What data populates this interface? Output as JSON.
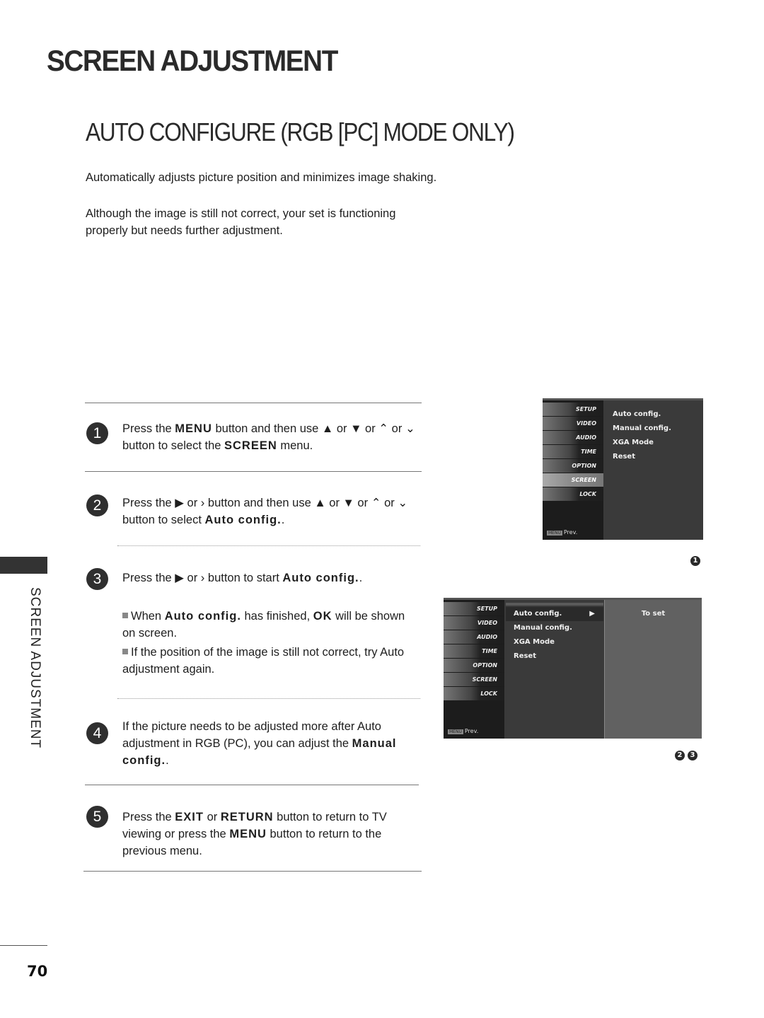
{
  "page": {
    "title": "SCREEN ADJUSTMENT",
    "section_title": "AUTO CONFIGURE (RGB [PC] MODE ONLY)",
    "side_label": "SCREEN ADJUSTMENT",
    "page_number": "70"
  },
  "intro": [
    "Automatically adjusts picture position and minimizes image shaking.",
    "Although the image is still not correct, your set is functioning properly but needs further adjustment."
  ],
  "steps": [
    {
      "num": "1",
      "parts": [
        "Press the ",
        "MENU",
        " button and then use ▲ or ▼  or ⌃ or ⌄  button to select the ",
        "SCREEN",
        " menu."
      ]
    },
    {
      "num": "2",
      "parts": [
        "Press the ▶  or  ›  button and then use ▲ or ▼  or ⌃  or ⌄  button to select ",
        "Auto config.",
        "."
      ]
    },
    {
      "num": "3",
      "parts": [
        "Press the ▶  or  ›  button to start ",
        "Auto config.",
        "."
      ],
      "notes": [
        {
          "parts": [
            "When ",
            "Auto config.",
            " has finished, ",
            "OK",
            " will be shown on screen."
          ]
        },
        {
          "parts": [
            "If the position of the image is still not correct, try Auto adjustment again."
          ]
        }
      ]
    },
    {
      "num": "4",
      "parts": [
        "If the picture needs to be adjusted more after Auto adjustment in RGB (PC), you can adjust the ",
        "Manual config.",
        "."
      ]
    },
    {
      "num": "5",
      "parts": [
        "Press the ",
        "EXIT",
        " or ",
        "RETURN",
        " button to return to TV viewing or press the ",
        "MENU",
        " button to return to the previous menu."
      ]
    }
  ],
  "osd_menu": {
    "categories": [
      "SETUP",
      "VIDEO",
      "AUDIO",
      "TIME",
      "OPTION",
      "SCREEN",
      "LOCK"
    ],
    "selected_category": "SCREEN",
    "prev_key": "MENU",
    "prev_label": "Prev.",
    "screen_items": [
      "Auto config.",
      "Manual config.",
      "XGA Mode",
      "Reset"
    ]
  },
  "osd_1": {
    "step_markers": [
      "1"
    ]
  },
  "osd_2": {
    "highlighted_item": "Auto config.",
    "arrow": "▶",
    "right_panel_text": "To set",
    "step_markers": [
      "2",
      "3"
    ]
  }
}
